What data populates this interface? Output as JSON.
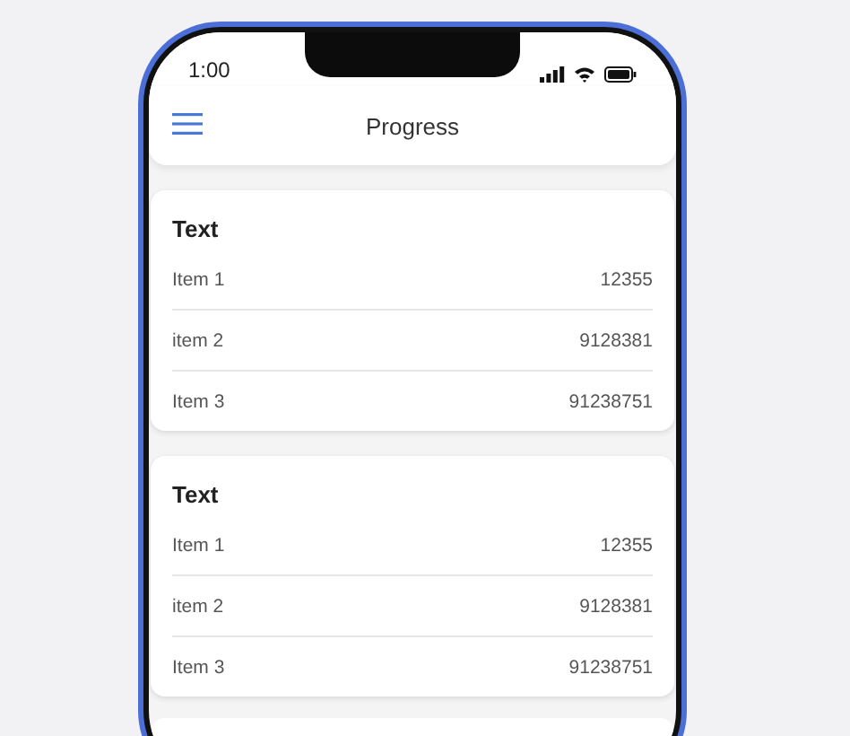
{
  "status_bar": {
    "time": "1:00"
  },
  "header": {
    "title": "Progress"
  },
  "cards": [
    {
      "title": "Text",
      "rows": [
        {
          "label": "Item 1",
          "value": "12355"
        },
        {
          "label": "item 2",
          "value": "9128381"
        },
        {
          "label": "Item 3",
          "value": "91238751"
        }
      ]
    },
    {
      "title": "Text",
      "rows": [
        {
          "label": "Item 1",
          "value": "12355"
        },
        {
          "label": "item 2",
          "value": "9128381"
        },
        {
          "label": "Item 3",
          "value": "91238751"
        }
      ]
    }
  ]
}
